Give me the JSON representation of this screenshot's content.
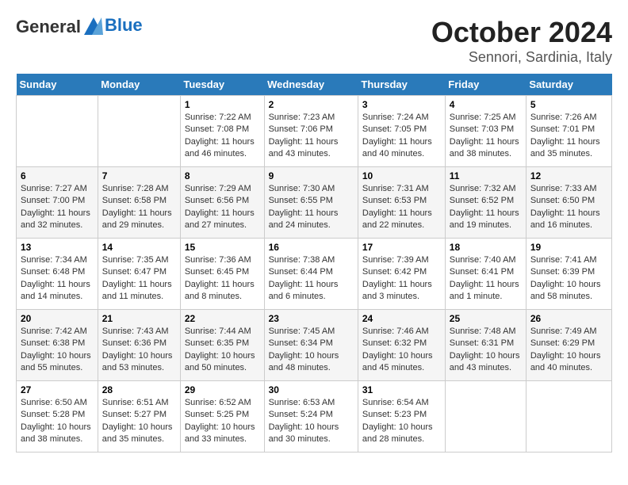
{
  "header": {
    "logo_line1": "General",
    "logo_line2": "Blue",
    "title": "October 2024",
    "subtitle": "Sennori, Sardinia, Italy"
  },
  "days_of_week": [
    "Sunday",
    "Monday",
    "Tuesday",
    "Wednesday",
    "Thursday",
    "Friday",
    "Saturday"
  ],
  "weeks": [
    [
      {
        "day": "",
        "sunrise": "",
        "sunset": "",
        "daylight": ""
      },
      {
        "day": "",
        "sunrise": "",
        "sunset": "",
        "daylight": ""
      },
      {
        "day": "1",
        "sunrise": "Sunrise: 7:22 AM",
        "sunset": "Sunset: 7:08 PM",
        "daylight": "Daylight: 11 hours and 46 minutes."
      },
      {
        "day": "2",
        "sunrise": "Sunrise: 7:23 AM",
        "sunset": "Sunset: 7:06 PM",
        "daylight": "Daylight: 11 hours and 43 minutes."
      },
      {
        "day": "3",
        "sunrise": "Sunrise: 7:24 AM",
        "sunset": "Sunset: 7:05 PM",
        "daylight": "Daylight: 11 hours and 40 minutes."
      },
      {
        "day": "4",
        "sunrise": "Sunrise: 7:25 AM",
        "sunset": "Sunset: 7:03 PM",
        "daylight": "Daylight: 11 hours and 38 minutes."
      },
      {
        "day": "5",
        "sunrise": "Sunrise: 7:26 AM",
        "sunset": "Sunset: 7:01 PM",
        "daylight": "Daylight: 11 hours and 35 minutes."
      }
    ],
    [
      {
        "day": "6",
        "sunrise": "Sunrise: 7:27 AM",
        "sunset": "Sunset: 7:00 PM",
        "daylight": "Daylight: 11 hours and 32 minutes."
      },
      {
        "day": "7",
        "sunrise": "Sunrise: 7:28 AM",
        "sunset": "Sunset: 6:58 PM",
        "daylight": "Daylight: 11 hours and 29 minutes."
      },
      {
        "day": "8",
        "sunrise": "Sunrise: 7:29 AM",
        "sunset": "Sunset: 6:56 PM",
        "daylight": "Daylight: 11 hours and 27 minutes."
      },
      {
        "day": "9",
        "sunrise": "Sunrise: 7:30 AM",
        "sunset": "Sunset: 6:55 PM",
        "daylight": "Daylight: 11 hours and 24 minutes."
      },
      {
        "day": "10",
        "sunrise": "Sunrise: 7:31 AM",
        "sunset": "Sunset: 6:53 PM",
        "daylight": "Daylight: 11 hours and 22 minutes."
      },
      {
        "day": "11",
        "sunrise": "Sunrise: 7:32 AM",
        "sunset": "Sunset: 6:52 PM",
        "daylight": "Daylight: 11 hours and 19 minutes."
      },
      {
        "day": "12",
        "sunrise": "Sunrise: 7:33 AM",
        "sunset": "Sunset: 6:50 PM",
        "daylight": "Daylight: 11 hours and 16 minutes."
      }
    ],
    [
      {
        "day": "13",
        "sunrise": "Sunrise: 7:34 AM",
        "sunset": "Sunset: 6:48 PM",
        "daylight": "Daylight: 11 hours and 14 minutes."
      },
      {
        "day": "14",
        "sunrise": "Sunrise: 7:35 AM",
        "sunset": "Sunset: 6:47 PM",
        "daylight": "Daylight: 11 hours and 11 minutes."
      },
      {
        "day": "15",
        "sunrise": "Sunrise: 7:36 AM",
        "sunset": "Sunset: 6:45 PM",
        "daylight": "Daylight: 11 hours and 8 minutes."
      },
      {
        "day": "16",
        "sunrise": "Sunrise: 7:38 AM",
        "sunset": "Sunset: 6:44 PM",
        "daylight": "Daylight: 11 hours and 6 minutes."
      },
      {
        "day": "17",
        "sunrise": "Sunrise: 7:39 AM",
        "sunset": "Sunset: 6:42 PM",
        "daylight": "Daylight: 11 hours and 3 minutes."
      },
      {
        "day": "18",
        "sunrise": "Sunrise: 7:40 AM",
        "sunset": "Sunset: 6:41 PM",
        "daylight": "Daylight: 11 hours and 1 minute."
      },
      {
        "day": "19",
        "sunrise": "Sunrise: 7:41 AM",
        "sunset": "Sunset: 6:39 PM",
        "daylight": "Daylight: 10 hours and 58 minutes."
      }
    ],
    [
      {
        "day": "20",
        "sunrise": "Sunrise: 7:42 AM",
        "sunset": "Sunset: 6:38 PM",
        "daylight": "Daylight: 10 hours and 55 minutes."
      },
      {
        "day": "21",
        "sunrise": "Sunrise: 7:43 AM",
        "sunset": "Sunset: 6:36 PM",
        "daylight": "Daylight: 10 hours and 53 minutes."
      },
      {
        "day": "22",
        "sunrise": "Sunrise: 7:44 AM",
        "sunset": "Sunset: 6:35 PM",
        "daylight": "Daylight: 10 hours and 50 minutes."
      },
      {
        "day": "23",
        "sunrise": "Sunrise: 7:45 AM",
        "sunset": "Sunset: 6:34 PM",
        "daylight": "Daylight: 10 hours and 48 minutes."
      },
      {
        "day": "24",
        "sunrise": "Sunrise: 7:46 AM",
        "sunset": "Sunset: 6:32 PM",
        "daylight": "Daylight: 10 hours and 45 minutes."
      },
      {
        "day": "25",
        "sunrise": "Sunrise: 7:48 AM",
        "sunset": "Sunset: 6:31 PM",
        "daylight": "Daylight: 10 hours and 43 minutes."
      },
      {
        "day": "26",
        "sunrise": "Sunrise: 7:49 AM",
        "sunset": "Sunset: 6:29 PM",
        "daylight": "Daylight: 10 hours and 40 minutes."
      }
    ],
    [
      {
        "day": "27",
        "sunrise": "Sunrise: 6:50 AM",
        "sunset": "Sunset: 5:28 PM",
        "daylight": "Daylight: 10 hours and 38 minutes."
      },
      {
        "day": "28",
        "sunrise": "Sunrise: 6:51 AM",
        "sunset": "Sunset: 5:27 PM",
        "daylight": "Daylight: 10 hours and 35 minutes."
      },
      {
        "day": "29",
        "sunrise": "Sunrise: 6:52 AM",
        "sunset": "Sunset: 5:25 PM",
        "daylight": "Daylight: 10 hours and 33 minutes."
      },
      {
        "day": "30",
        "sunrise": "Sunrise: 6:53 AM",
        "sunset": "Sunset: 5:24 PM",
        "daylight": "Daylight: 10 hours and 30 minutes."
      },
      {
        "day": "31",
        "sunrise": "Sunrise: 6:54 AM",
        "sunset": "Sunset: 5:23 PM",
        "daylight": "Daylight: 10 hours and 28 minutes."
      },
      {
        "day": "",
        "sunrise": "",
        "sunset": "",
        "daylight": ""
      },
      {
        "day": "",
        "sunrise": "",
        "sunset": "",
        "daylight": ""
      }
    ]
  ]
}
